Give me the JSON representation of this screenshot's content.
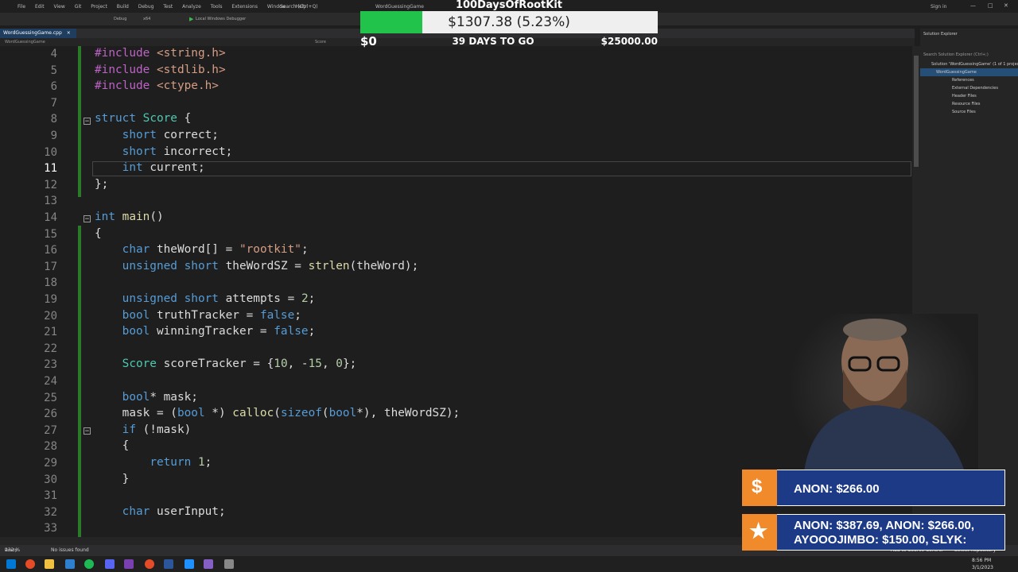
{
  "window": {
    "menu": [
      "File",
      "Edit",
      "View",
      "Git",
      "Project",
      "Build",
      "Debug",
      "Test",
      "Analyze",
      "Tools",
      "Extensions",
      "Window",
      "Help"
    ],
    "search": "Search (Ctrl+Q)",
    "solution_title": "WordGuessingGame",
    "signin": "Sign in"
  },
  "toolbar": {
    "config": "Debug",
    "platform": "x64",
    "debugger": "Local Windows Debugger"
  },
  "doc_tab": {
    "label": "WordGuessingGame.cpp",
    "close": "×"
  },
  "navbar": {
    "project": "WordGuessingGame",
    "scope": "Score"
  },
  "editor": {
    "current_line": 11,
    "lines": [
      {
        "num": "4",
        "code": "#include <string.h>"
      },
      {
        "num": "5",
        "code": "#include <stdlib.h>"
      },
      {
        "num": "6",
        "code": "#include <ctype.h>"
      },
      {
        "num": "7",
        "code": ""
      },
      {
        "num": "8",
        "code": "struct Score {"
      },
      {
        "num": "9",
        "code": "    short correct;"
      },
      {
        "num": "10",
        "code": "    short incorrect;"
      },
      {
        "num": "11",
        "code": "    int current;"
      },
      {
        "num": "12",
        "code": "};"
      },
      {
        "num": "13",
        "code": ""
      },
      {
        "num": "14",
        "code": "int main()"
      },
      {
        "num": "15",
        "code": "{"
      },
      {
        "num": "16",
        "code": "    char theWord[] = \"rootkit\";"
      },
      {
        "num": "17",
        "code": "    unsigned short theWordSZ = strlen(theWord);"
      },
      {
        "num": "18",
        "code": ""
      },
      {
        "num": "19",
        "code": "    unsigned short attempts = 2;"
      },
      {
        "num": "20",
        "code": "    bool truthTracker = false;"
      },
      {
        "num": "21",
        "code": "    bool winningTracker = false;"
      },
      {
        "num": "22",
        "code": ""
      },
      {
        "num": "23",
        "code": "    Score scoreTracker = {10, -15, 0};"
      },
      {
        "num": "24",
        "code": ""
      },
      {
        "num": "25",
        "code": "    bool* mask;"
      },
      {
        "num": "26",
        "code": "    mask = (bool *) calloc(sizeof(bool*), theWordSZ);"
      },
      {
        "num": "27",
        "code": "    if (!mask)"
      },
      {
        "num": "28",
        "code": "    {"
      },
      {
        "num": "29",
        "code": "        return 1;"
      },
      {
        "num": "30",
        "code": "    }"
      },
      {
        "num": "31",
        "code": ""
      },
      {
        "num": "32",
        "code": "    char userInput;"
      },
      {
        "num": "33",
        "code": ""
      }
    ]
  },
  "solution_explorer": {
    "title": "Solution Explorer",
    "search": "Search Solution Explorer (Ctrl+;)",
    "items": [
      "Solution 'WordGuessingGame' (1 of 1 project)",
      "WordGuessingGame",
      "References",
      "External Dependencies",
      "Header Files",
      "Resource Files",
      "Source Files"
    ]
  },
  "statusbar": {
    "state": "Ready",
    "zoom": "232 %",
    "issues": "No issues found",
    "source_control": "Add to Source Control",
    "repo": "Select Repository"
  },
  "taskbar": {
    "time": "8:56 PM",
    "date": "3/1/2023"
  },
  "goal_overlay": {
    "title": "100DaysOfRootKit",
    "amount": "$1307.38 (5.23%)",
    "progress": 0.0523,
    "start": "$0",
    "days": "39 DAYS TO GO",
    "target": "$25000.00"
  },
  "alerts": [
    {
      "text": "ANON: $266.00",
      "icon": "$"
    },
    {
      "line1": "ANON: $387.69, ANON: $266.00,",
      "line2": "AYOOOJIMBO: $150.00, SLYK:",
      "icon": "★"
    }
  ],
  "colors": {
    "accent_green": "#22c34a",
    "alert_blue": "#1c3a86",
    "alert_orange": "#f08a2a",
    "editor_bg": "#1e1e1e"
  }
}
